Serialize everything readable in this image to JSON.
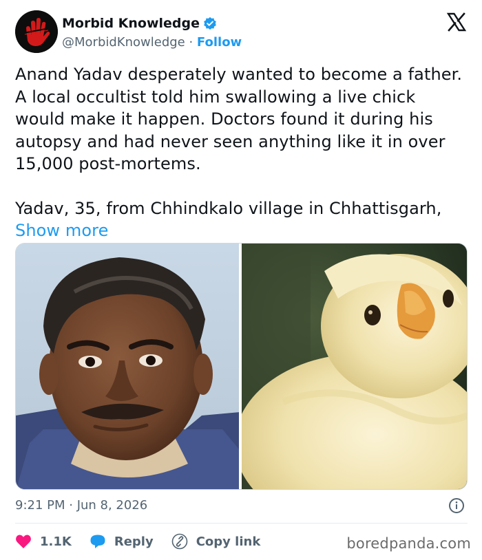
{
  "author": {
    "name": "Morbid Knowledge",
    "handle": "@MorbidKnowledge",
    "separator": " · ",
    "follow_label": "Follow",
    "avatar_icon": "red-handprint-logo",
    "verified_icon": "verified-badge-icon",
    "platform_icon": "x-logo-icon"
  },
  "tweet": {
    "paragraph1": "Anand Yadav desperately wanted to become a father. A local occultist told him swallowing a live chick would make it happen. Doctors found it during his autopsy and had never seen anything like it in over 15,000 post-mortems.",
    "paragraph2": "Yadav, 35, from Chhindkalo village in Chhattisgarh, ",
    "show_more": "Show more"
  },
  "media": {
    "left_photo": "portrait-of-man",
    "right_photo": "yellow-chick"
  },
  "meta": {
    "timestamp": "9:21 PM · Jun 8, 2026"
  },
  "actions": {
    "likes": "1.1K",
    "reply": "Reply",
    "copy_link": "Copy link"
  },
  "watermark": "boredpanda.com",
  "colors": {
    "accent": "#1d9bf0",
    "like": "#f91880",
    "text": "#0f1419",
    "muted": "#536471"
  }
}
